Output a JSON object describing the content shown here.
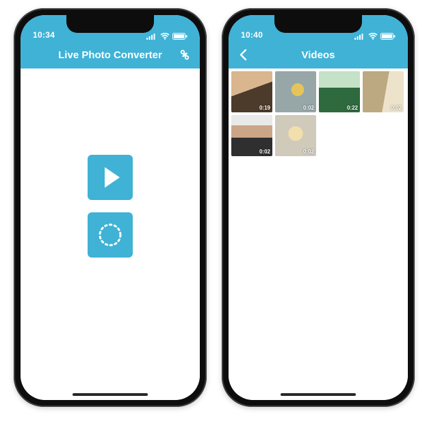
{
  "theme": {
    "accent": "#3fb2d6",
    "white": "#ffffff"
  },
  "screen1": {
    "status_time": "10:34",
    "nav_title": "Live Photo Converter",
    "settings_icon": "settings-icon",
    "play_button_label": "play-icon",
    "loading_button_label": "live-photo-icon"
  },
  "screen2": {
    "status_time": "10:40",
    "nav_title": "Videos",
    "back_icon": "chevron-left-icon",
    "videos": [
      {
        "duration": "0:19",
        "thumb_class": "th1"
      },
      {
        "duration": "0:02",
        "thumb_class": "th2"
      },
      {
        "duration": "0:22",
        "thumb_class": "th3"
      },
      {
        "duration": "0:02",
        "thumb_class": "th4"
      },
      {
        "duration": "0:02",
        "thumb_class": "th5"
      },
      {
        "duration": "0:02",
        "thumb_class": "th6"
      }
    ]
  }
}
